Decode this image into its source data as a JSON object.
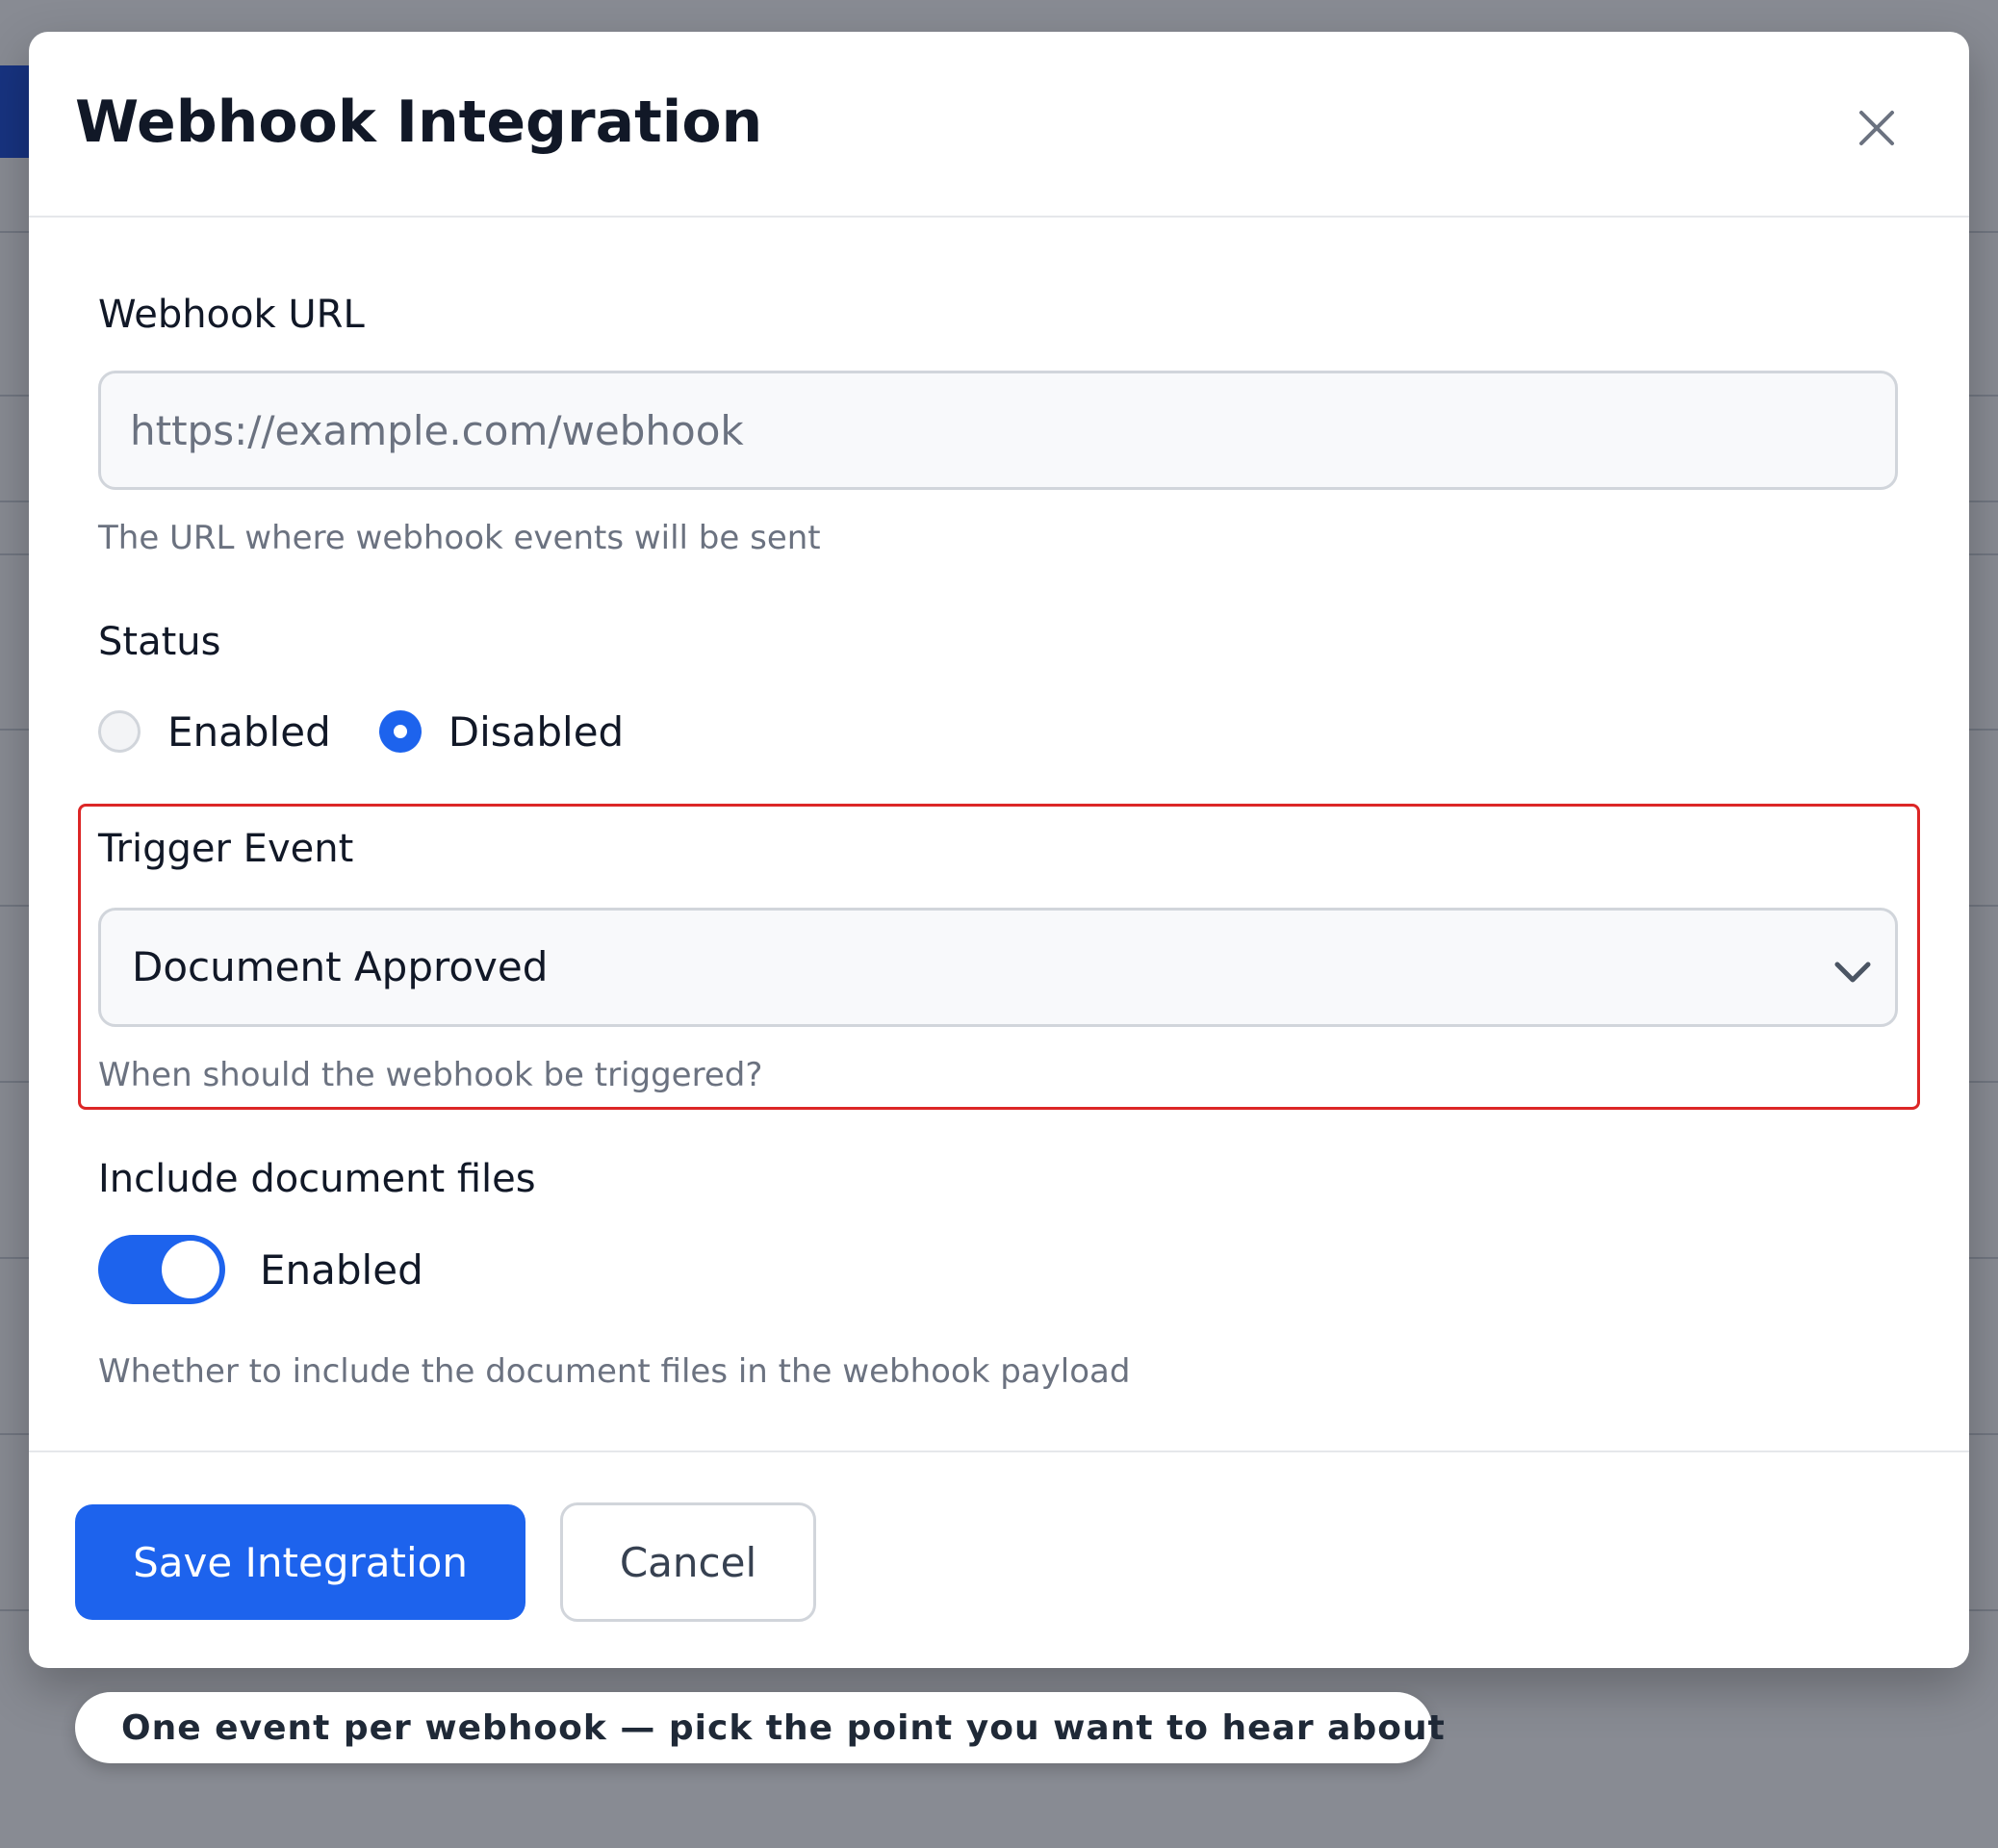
{
  "modal": {
    "title": "Webhook Integration",
    "close_icon": "close-icon"
  },
  "webhook_url": {
    "label": "Webhook URL",
    "value": "",
    "placeholder": "https://example.com/webhook",
    "hint": "The URL where webhook events will be sent"
  },
  "status": {
    "label": "Status",
    "options": [
      {
        "label": "Enabled",
        "checked": false
      },
      {
        "label": "Disabled",
        "checked": true
      }
    ]
  },
  "trigger_event": {
    "label": "Trigger Event",
    "selected": "Document Approved",
    "hint": "When should the webhook be triggered?",
    "chevron_icon": "chevron-down-icon"
  },
  "include_files": {
    "label": "Include document files",
    "toggle_on": true,
    "toggle_label": "Enabled",
    "hint": "Whether to include the document files in the webhook payload"
  },
  "footer": {
    "save_label": "Save Integration",
    "cancel_label": "Cancel"
  },
  "tip": {
    "text": "One event per webhook — pick the point you want to hear about"
  },
  "colors": {
    "accent": "#1d63ed",
    "highlight": "#dc2626",
    "overlay": "#888b94"
  }
}
